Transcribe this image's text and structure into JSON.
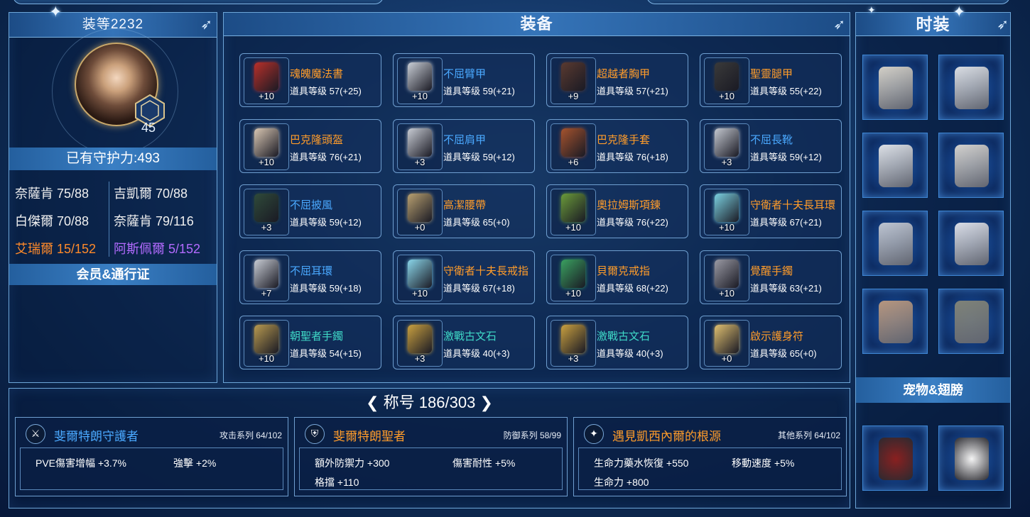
{
  "left": {
    "gear_score": "装等2232",
    "level": "45",
    "guard_power": "已有守护力:493",
    "stats": [
      {
        "text": "奈薩肯 75/88",
        "color": "#f0f0f0"
      },
      {
        "text": "吉凱爾 70/88",
        "color": "#f0f0f0"
      },
      {
        "text": "白傑爾 70/88",
        "color": "#f0f0f0"
      },
      {
        "text": "奈薩肯 79/116",
        "color": "#f0f0f0"
      },
      {
        "text": "艾瑞爾 15/152",
        "color": "#ff8a2a"
      },
      {
        "text": "阿斯佩爾 5/152",
        "color": "#b36bff"
      }
    ],
    "member": "会员&通行证"
  },
  "equip": {
    "title": "装备",
    "items": [
      {
        "name": "魂魄魔法書",
        "level": "道具等级 57(+25)",
        "plus": "+10",
        "color": "orange",
        "icon": "magic-book-icon",
        "tint": "#b8302a"
      },
      {
        "name": "不屈臂甲",
        "level": "道具等级 59(+21)",
        "plus": "+10",
        "color": "blue",
        "icon": "bracer-icon",
        "tint": "#c9ced6"
      },
      {
        "name": "超越者胸甲",
        "level": "道具等级 57(+21)",
        "plus": "+9",
        "color": "orange",
        "icon": "chest-armor-icon",
        "tint": "#5a3a30"
      },
      {
        "name": "聖靈腿甲",
        "level": "道具等级 55(+22)",
        "plus": "+10",
        "color": "orange",
        "icon": "leg-armor-icon",
        "tint": "#3a3a3a"
      },
      {
        "name": "巴克隆頭盔",
        "level": "道具等级 76(+21)",
        "plus": "+10",
        "color": "orange",
        "icon": "helmet-icon",
        "tint": "#d9c7b3"
      },
      {
        "name": "不屈肩甲",
        "level": "道具等级 59(+12)",
        "plus": "+3",
        "color": "blue",
        "icon": "shoulder-armor-icon",
        "tint": "#c8ccd4"
      },
      {
        "name": "巴克隆手套",
        "level": "道具等级 76(+18)",
        "plus": "+6",
        "color": "orange",
        "icon": "gloves-icon",
        "tint": "#a5532e"
      },
      {
        "name": "不屈長靴",
        "level": "道具等级 59(+12)",
        "plus": "+3",
        "color": "blue",
        "icon": "boots-icon",
        "tint": "#c4c8d0"
      },
      {
        "name": "不屈披風",
        "level": "道具等级 59(+12)",
        "plus": "+3",
        "color": "blue",
        "icon": "cape-icon",
        "tint": "#2f4a3a"
      },
      {
        "name": "高潔腰帶",
        "level": "道具等级 65(+0)",
        "plus": "+0",
        "color": "orange",
        "icon": "belt-icon",
        "tint": "#b8a070"
      },
      {
        "name": "奧拉姆斯項鍊",
        "level": "道具等级 76(+22)",
        "plus": "+10",
        "color": "orange",
        "icon": "necklace-icon",
        "tint": "#6a9a3a"
      },
      {
        "name": "守衛者十夫長耳環",
        "level": "道具等级 67(+21)",
        "plus": "+10",
        "color": "orange",
        "icon": "earring-icon",
        "tint": "#7ad0e0"
      },
      {
        "name": "不屈耳環",
        "level": "道具等级 59(+18)",
        "plus": "+7",
        "color": "blue",
        "icon": "earring-icon",
        "tint": "#c8ccd4"
      },
      {
        "name": "守衛者十夫長戒指",
        "level": "道具等级 67(+18)",
        "plus": "+10",
        "color": "orange",
        "icon": "ring-icon",
        "tint": "#8ad6ea"
      },
      {
        "name": "貝爾克戒指",
        "level": "道具等级 68(+22)",
        "plus": "+10",
        "color": "orange",
        "icon": "ring-icon",
        "tint": "#3aa060"
      },
      {
        "name": "覺醒手鐲",
        "level": "道具等级 63(+21)",
        "plus": "+10",
        "color": "orange",
        "icon": "bracelet-icon",
        "tint": "#9a9aa4"
      },
      {
        "name": "朝聖者手鐲",
        "level": "道具等级 54(+15)",
        "plus": "+10",
        "color": "teal",
        "icon": "bracelet-icon",
        "tint": "#b89a50"
      },
      {
        "name": "激戰古文石",
        "level": "道具等级 40(+3)",
        "plus": "+3",
        "color": "teal",
        "icon": "runestone-icon",
        "tint": "#c9a040"
      },
      {
        "name": "激戰古文石",
        "level": "道具等级 40(+3)",
        "plus": "+3",
        "color": "teal",
        "icon": "runestone-icon",
        "tint": "#c9a040"
      },
      {
        "name": "啟示護身符",
        "level": "道具等级 65(+0)",
        "plus": "+0",
        "color": "orange",
        "icon": "amulet-icon",
        "tint": "#e0c070"
      }
    ]
  },
  "fashion": {
    "title": "时装",
    "slots": [
      {
        "icon": "costume-top-icon",
        "tint": "#e8e0d0"
      },
      {
        "icon": "costume-pants-icon",
        "tint": "#f0f0f0"
      },
      {
        "icon": "costume-gloves-icon",
        "tint": "#f2f2f2"
      },
      {
        "icon": "costume-boots-icon",
        "tint": "#e8e2d8"
      },
      {
        "icon": "costume-weapon-icon",
        "tint": "#d0d4dc"
      },
      {
        "icon": "costume-headpiece-icon",
        "tint": "#f0f0f4"
      },
      {
        "icon": "costume-feather-icon",
        "tint": "#c8a080"
      },
      {
        "icon": "costume-book-icon",
        "tint": "#8a8a78"
      }
    ],
    "pet_label": "宠物&翅膀",
    "pets": [
      {
        "icon": "pet-icon",
        "tint": "#8a2020"
      },
      {
        "icon": "wings-icon",
        "tint": "#f4f4f4"
      }
    ]
  },
  "titles": {
    "header": "称号 186/303",
    "cards": [
      {
        "name": "斐爾特朗守護者",
        "color": "#4aa9ff",
        "series": "攻击系列 64/102",
        "icon": "sword-icon",
        "effects": [
          "PVE傷害增幅 +3.7%",
          "強擊 +2%"
        ]
      },
      {
        "name": "斐爾特朗聖者",
        "color": "#ff9c2a",
        "series": "防御系列 58/99",
        "icon": "shield-icon",
        "effects": [
          "額外防禦力 +300",
          "傷害耐性 +5%",
          "格擋 +110"
        ]
      },
      {
        "name": "遇見凱西內爾的根源",
        "color": "#ff9c2a",
        "series": "其他系列 64/102",
        "icon": "star-icon",
        "effects": [
          "生命力藥水恢復 +550",
          "移動速度 +5%",
          "生命力 +800"
        ]
      }
    ]
  },
  "colors": {
    "orange": "#ff9c2a",
    "blue": "#4aa9ff",
    "teal": "#3fd9c7"
  }
}
